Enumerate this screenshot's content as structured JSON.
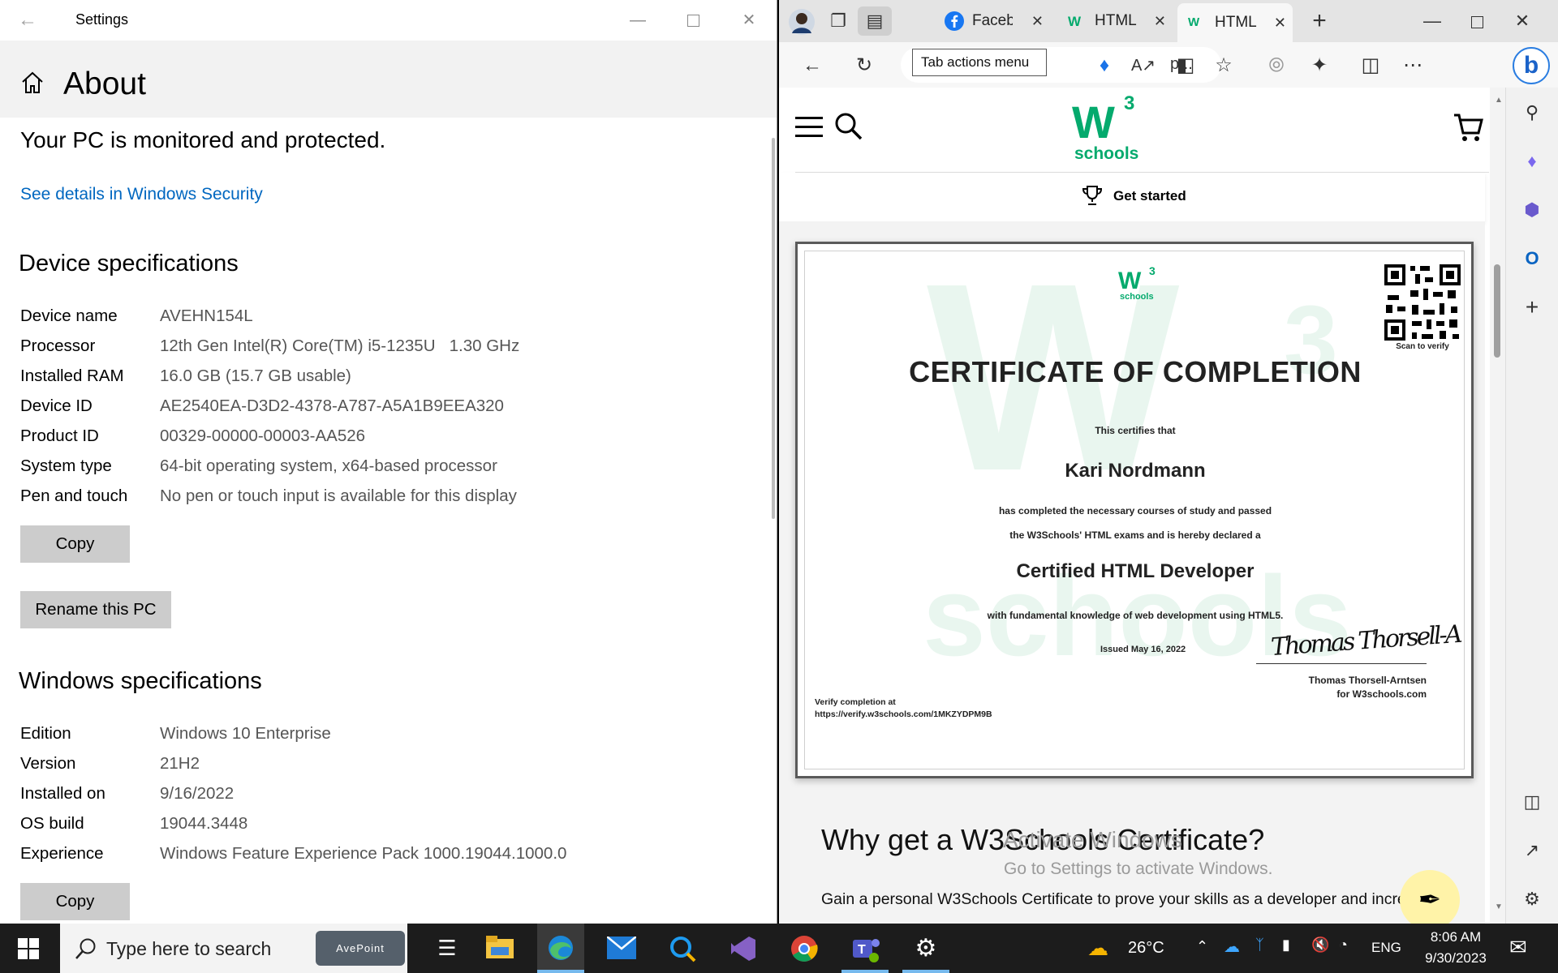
{
  "settings": {
    "window_title": "Settings",
    "page_title": "About",
    "protected_text": "Your PC is monitored and protected.",
    "security_link": "See details in Windows Security",
    "device_heading": "Device specifications",
    "device_specs": [
      {
        "k": "Device name",
        "v": "AVEHN154L"
      },
      {
        "k": "Processor",
        "v": "12th Gen Intel(R) Core(TM) i5-1235U   1.30 GHz"
      },
      {
        "k": "Installed RAM",
        "v": "16.0 GB (15.7 GB usable)"
      },
      {
        "k": "Device ID",
        "v": "AE2540EA-D3D2-4378-A787-A5A1B9EEA320"
      },
      {
        "k": "Product ID",
        "v": "00329-00000-00003-AA526"
      },
      {
        "k": "System type",
        "v": "64-bit operating system, x64-based processor"
      },
      {
        "k": "Pen and touch",
        "v": "No pen or touch input is available for this display"
      }
    ],
    "copy_label": "Copy",
    "rename_label": "Rename this PC",
    "windows_heading": "Windows specifications",
    "windows_specs": [
      {
        "k": "Edition",
        "v": "Windows 10 Enterprise"
      },
      {
        "k": "Version",
        "v": "21H2"
      },
      {
        "k": "Installed on",
        "v": "9/16/2022"
      },
      {
        "k": "OS build",
        "v": "19044.3448"
      },
      {
        "k": "Experience",
        "v": "Windows Feature Experience Pack 1000.19044.1000.0"
      }
    ],
    "copy2_label": "Copy"
  },
  "browser": {
    "tabs": [
      {
        "label": "Facebo"
      },
      {
        "label": "HTML"
      },
      {
        "label": "HTML"
      }
    ],
    "tooltip": "Tab actions menu",
    "addr_trunc": "p...",
    "colors": {
      "w3_green": "#04aa6d",
      "fb_blue": "#1877f2",
      "edge_blue": "#0c59a4"
    }
  },
  "w3": {
    "logo_w": "W",
    "logo_sup": "3",
    "logo_schools": "schools",
    "get_started": "Get started",
    "cert": {
      "scan": "Scan to verify",
      "title": "CERTIFICATE OF COMPLETION",
      "certifies": "This certifies that",
      "name": "Kari Nordmann",
      "line1": "has completed the necessary courses of study and passed",
      "line2": "the W3Schools' HTML exams and is hereby declared a",
      "role": "Certified HTML Developer",
      "line3": "with fundamental knowledge of web development using HTML5.",
      "issued": "Issued May 16, 2022",
      "signer": "Thomas Thorsell-Arntsen",
      "signer_org": "for W3schools.com",
      "verify_label": "Verify completion at",
      "verify_url": "https://verify.w3schools.com/1MKZYDPM9B",
      "signature": "Thomas Thorsell-A"
    },
    "why_heading": "Why get a W3Schools Certificate?",
    "gain_text": "Gain a personal W3Schools Certificate to prove your skills as a developer and incre"
  },
  "watermark": {
    "line1": "Activate Windows",
    "line2": "Go to Settings to activate Windows."
  },
  "taskbar": {
    "search_placeholder": "Type here to search",
    "avepoint": "AvePoint",
    "weather": "26°C",
    "lang": "ENG",
    "time": "8:06 AM",
    "date": "9/30/2023"
  }
}
